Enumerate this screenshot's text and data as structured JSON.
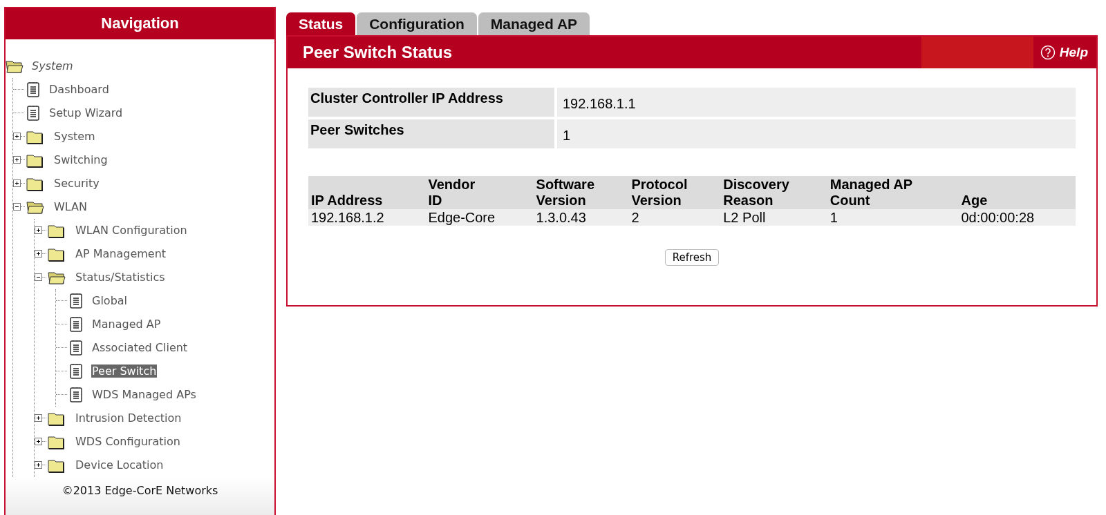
{
  "navigation": {
    "title": "Navigation",
    "tree": [
      {
        "label": "System",
        "kind": "root",
        "expanded": true,
        "children": [
          {
            "label": "Dashboard",
            "kind": "page",
            "selected": false
          },
          {
            "label": "Setup Wizard",
            "kind": "page",
            "selected": false
          },
          {
            "label": "System",
            "kind": "folder",
            "expanded": false
          },
          {
            "label": "Switching",
            "kind": "folder",
            "expanded": false
          },
          {
            "label": "Security",
            "kind": "folder",
            "expanded": false
          },
          {
            "label": "WLAN",
            "kind": "folder",
            "expanded": true,
            "children": [
              {
                "label": "WLAN Configuration",
                "kind": "folder",
                "expanded": false
              },
              {
                "label": "AP Management",
                "kind": "folder",
                "expanded": false
              },
              {
                "label": "Status/Statistics",
                "kind": "folder",
                "expanded": true,
                "children": [
                  {
                    "label": "Global",
                    "kind": "page",
                    "selected": false
                  },
                  {
                    "label": "Managed AP",
                    "kind": "page",
                    "selected": false
                  },
                  {
                    "label": "Associated Client",
                    "kind": "page",
                    "selected": false
                  },
                  {
                    "label": "Peer Switch",
                    "kind": "page",
                    "selected": true
                  },
                  {
                    "label": "WDS Managed APs",
                    "kind": "page",
                    "selected": false
                  }
                ]
              },
              {
                "label": "Intrusion Detection",
                "kind": "folder",
                "expanded": false
              },
              {
                "label": "WDS Configuration",
                "kind": "folder",
                "expanded": false
              },
              {
                "label": "Device Location",
                "kind": "folder",
                "expanded": false
              }
            ]
          }
        ]
      }
    ],
    "footer": "©2013 Edge-CorE Networks"
  },
  "tabs": [
    {
      "label": "Status",
      "selected": true
    },
    {
      "label": "Configuration",
      "selected": false
    },
    {
      "label": "Managed AP",
      "selected": false
    }
  ],
  "panel": {
    "title": "Peer Switch Status",
    "help": "Help",
    "summary": [
      {
        "label": "Cluster Controller IP Address",
        "value": "192.168.1.1"
      },
      {
        "label": "Peer Switches",
        "value": "1"
      }
    ],
    "table": {
      "columns": [
        "IP Address",
        "Vendor\nID",
        "Software\nVersion",
        "Protocol\nVersion",
        "Discovery\nReason",
        "Managed AP\nCount",
        "Age"
      ],
      "rows": [
        [
          "192.168.1.2",
          "Edge-Core",
          "1.3.0.43",
          "2",
          "L2 Poll",
          "1",
          "0d:00:00:28"
        ]
      ]
    },
    "buttons": [
      "Refresh"
    ]
  }
}
